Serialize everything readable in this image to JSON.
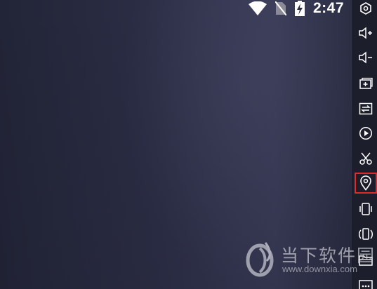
{
  "status_bar": {
    "time": "2:47",
    "icons": [
      "wifi-icon",
      "no-sim-icon",
      "battery-charging-icon"
    ]
  },
  "toolbar": {
    "items": [
      {
        "name": "settings-hexagon-icon"
      },
      {
        "name": "volume-up-icon"
      },
      {
        "name": "volume-down-icon"
      },
      {
        "name": "add-app-icon"
      },
      {
        "name": "sync-transfer-icon"
      },
      {
        "name": "play-record-icon"
      },
      {
        "name": "screenshot-scissors-icon"
      },
      {
        "name": "location-pin-icon",
        "selected": true
      },
      {
        "name": "shake-vibrate-icon"
      },
      {
        "name": "rotate-screen-icon"
      },
      {
        "name": "folder-icon"
      },
      {
        "name": "more-icon"
      }
    ],
    "selected_color": "#e02a2a"
  },
  "watermark": {
    "title": "当下软件园",
    "url": "www.downxia.com"
  },
  "colors": {
    "background": "#2a2c42",
    "toolbar": "#1c1e2c",
    "icon": "#ffffff"
  }
}
